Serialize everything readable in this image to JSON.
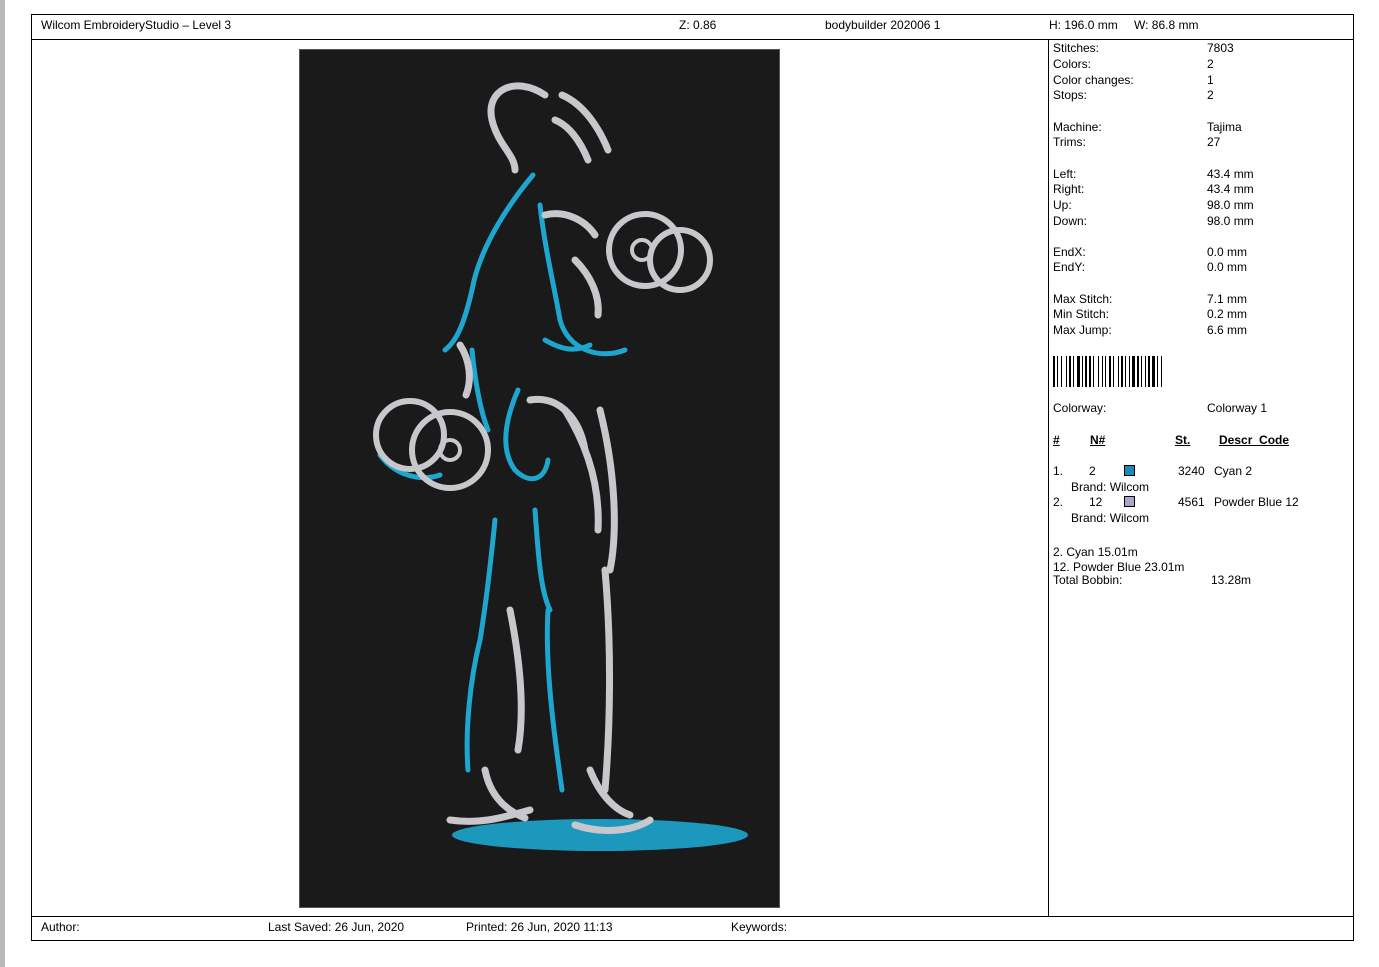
{
  "header": {
    "app_title": "Wilcom EmbroideryStudio – Level 3",
    "zoom": "Z: 0.86",
    "design_name": "bodybuilder 202006 1",
    "height": "H: 196.0 mm",
    "width": "W: 86.8 mm"
  },
  "stats": {
    "stitches_label": "Stitches:",
    "stitches": "7803",
    "colors_label": "Colors:",
    "colors": "2",
    "color_changes_label": "Color changes:",
    "color_changes": "1",
    "stops_label": "Stops:",
    "stops": "2",
    "machine_label": "Machine:",
    "machine": "Tajima",
    "trims_label": "Trims:",
    "trims": "27",
    "left_label": "Left:",
    "left": "43.4 mm",
    "right_label": "Right:",
    "right": "43.4 mm",
    "up_label": "Up:",
    "up": "98.0 mm",
    "down_label": "Down:",
    "down": "98.0 mm",
    "endx_label": "EndX:",
    "endx": "0.0 mm",
    "endy_label": "EndY:",
    "endy": "0.0 mm",
    "max_stitch_label": "Max Stitch:",
    "max_stitch": "7.1 mm",
    "min_stitch_label": "Min Stitch:",
    "min_stitch": "0.2 mm",
    "max_jump_label": "Max Jump:",
    "max_jump": "6.6 mm"
  },
  "colorway": {
    "label": "Colorway:",
    "value": "Colorway 1"
  },
  "color_table": {
    "headers": [
      "#",
      "N#",
      "St.",
      "Descr_Code"
    ],
    "rows": [
      {
        "index": "1.",
        "n": "2",
        "swatch_color": "#1b87c0",
        "stitches": "3240",
        "descr": "Cyan 2",
        "brand": "Brand: Wilcom"
      },
      {
        "index": "2.",
        "n": "12",
        "swatch_color": "#a9a6c9",
        "stitches": "4561",
        "descr": "Powder Blue 12",
        "brand": "Brand: Wilcom"
      }
    ]
  },
  "thread_usage": {
    "line1": "2. Cyan 15.01m",
    "line2": "12. Powder Blue 23.01m",
    "bobbin_label": "Total Bobbin:",
    "bobbin": "13.28m"
  },
  "footer": {
    "author": "Author:",
    "last_saved": "Last Saved: 26 Jun, 2020",
    "printed": "Printed: 26 Jun, 2020 11:13",
    "keywords": "Keywords:"
  },
  "colors": {
    "background": "#1a1a1a",
    "cyan_thread": "#1ea6cf",
    "silver_thread": "#c8c8cc"
  }
}
